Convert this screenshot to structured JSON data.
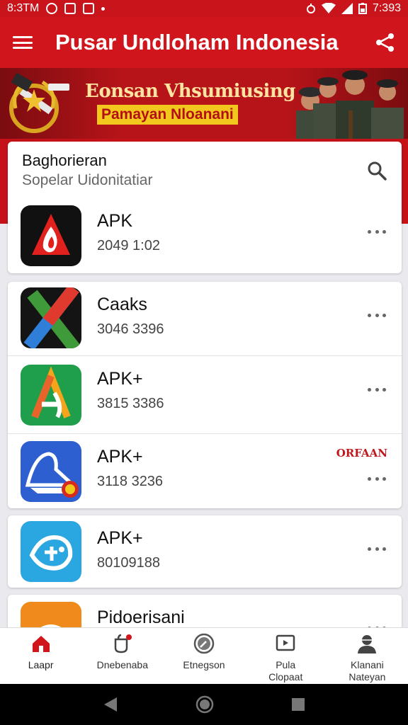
{
  "status_bar": {
    "time_left": "8:3TM",
    "time_right": "7:393",
    "icons": [
      "circle-icon",
      "square-icon",
      "square-icon",
      "dot-icon",
      "alarm-icon",
      "wifi-icon",
      "signal-icon",
      "battery-icon"
    ]
  },
  "app_bar": {
    "title": "Pusar Undloham Indonesia",
    "menu_icon": "hamburger-menu-icon",
    "share_icon": "share-icon"
  },
  "banner": {
    "title": "Eonsan Vhsumiusing",
    "subtitle": "Pamayan Nloanani"
  },
  "search": {
    "title": "Baghorieran",
    "subtitle": "Sopelar Uidonitatiar",
    "icon": "search-icon"
  },
  "apps": [
    {
      "name": "APK",
      "meta": "2049 1:02",
      "icon": "flame-icon",
      "tag": ""
    },
    {
      "name": "Caaks",
      "meta": "3046 3396",
      "icon": "x-logo-icon",
      "tag": ""
    },
    {
      "name": "APK+",
      "meta": "3815 3386",
      "icon": "letter-a-icon",
      "tag": ""
    },
    {
      "name": "APK+",
      "meta": "3118 3236",
      "icon": "boat-logo-icon",
      "tag": "ORFAAN"
    },
    {
      "name": "APK+",
      "meta": "80109188",
      "icon": "fish-logo-icon",
      "tag": ""
    },
    {
      "name": "Pidoerisani",
      "meta": "",
      "icon": "orange-logo-icon",
      "tag": ""
    }
  ],
  "bottom_nav": [
    {
      "label": "Laapr",
      "icon": "home-icon",
      "active": true
    },
    {
      "label": "Dnebenaba",
      "icon": "notification-icon",
      "active": false
    },
    {
      "label": "Etnegson",
      "icon": "compass-icon",
      "active": false
    },
    {
      "label": "Pula\nClopaat",
      "icon": "tablet-icon",
      "active": false
    },
    {
      "label": "Klanani\nNateyan",
      "icon": "profile-icon",
      "active": false
    }
  ],
  "colors": {
    "primary": "#d0161c",
    "banner_accent": "#f2c81f",
    "background": "#e9e9ee"
  }
}
